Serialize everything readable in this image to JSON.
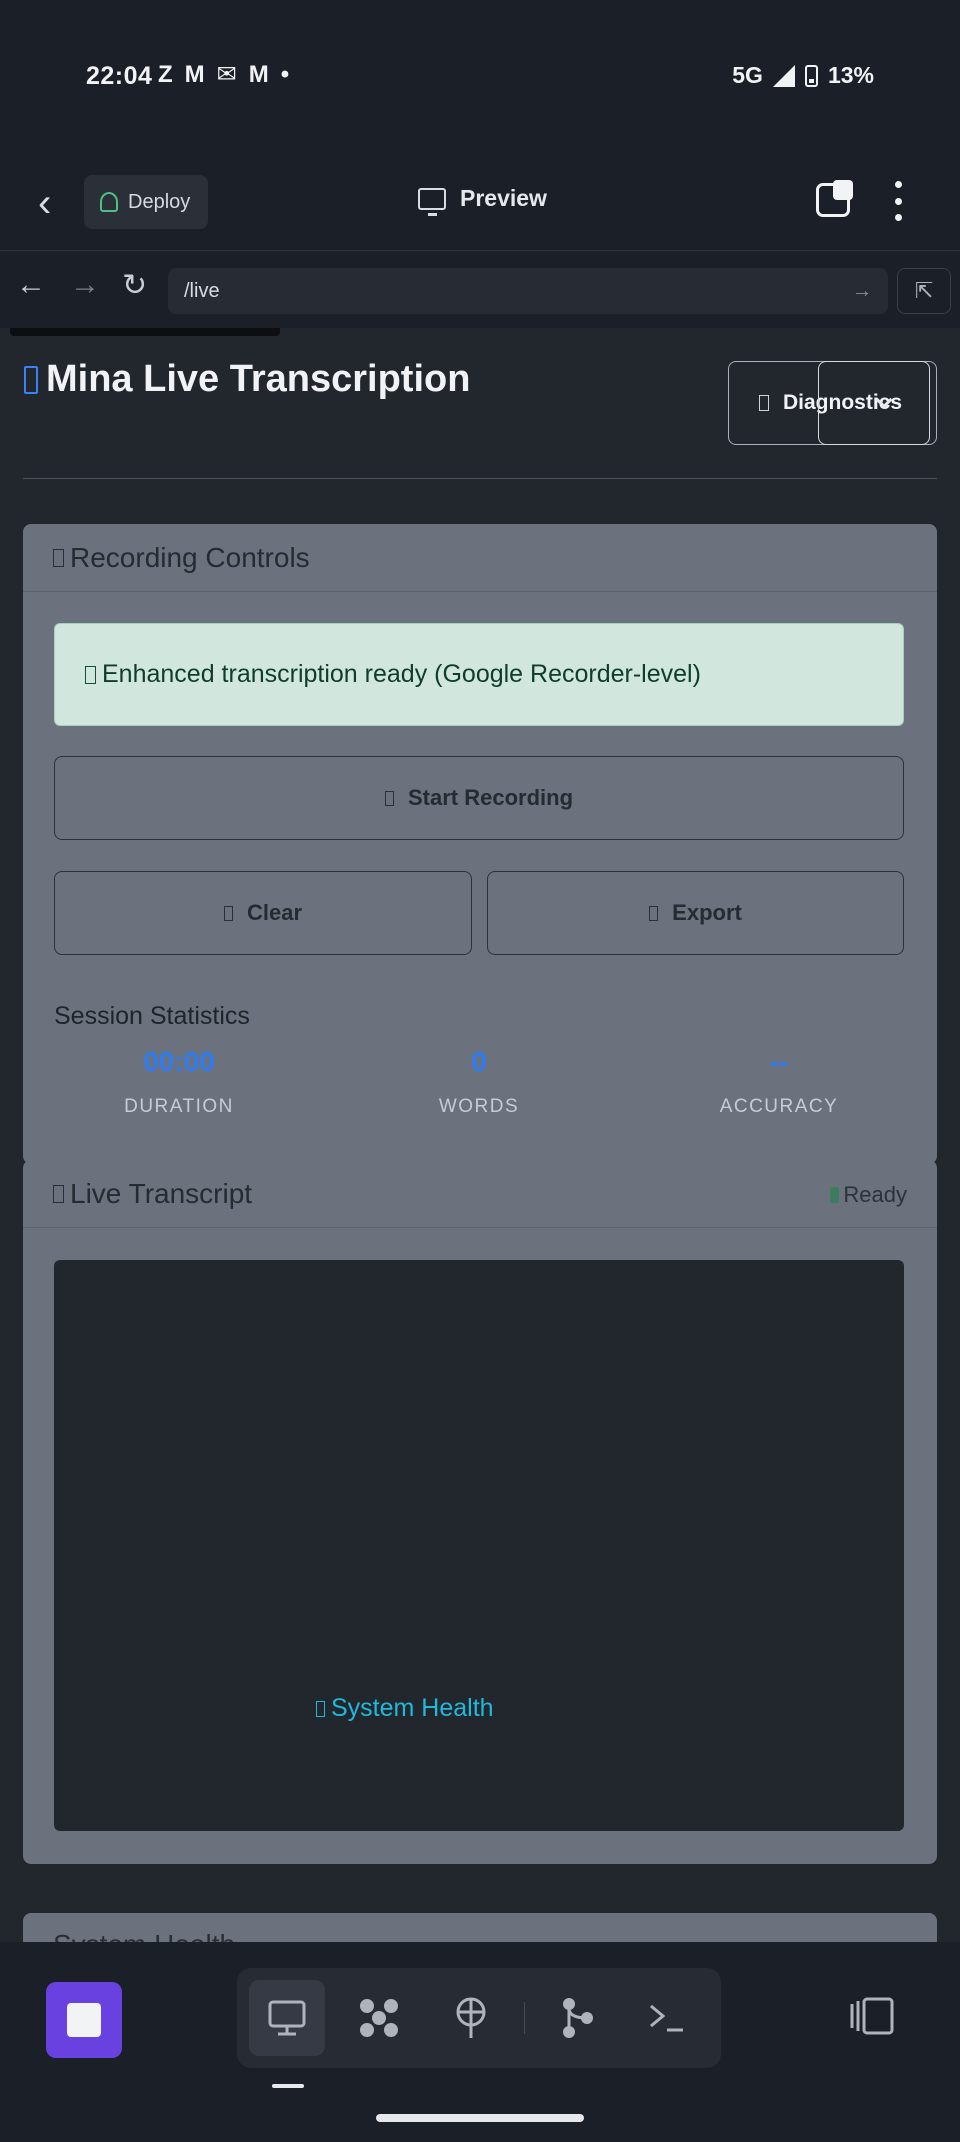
{
  "status_bar": {
    "time": "22:04",
    "notification_icons": [
      "Z",
      "M",
      "✉",
      "M",
      "•"
    ],
    "network": "5G",
    "battery": "13%"
  },
  "app_header": {
    "deploy_label": "Deploy",
    "preview_label": "Preview"
  },
  "browser": {
    "url": "/live"
  },
  "page": {
    "title": "Mina Live Transcription",
    "diagnostics_label": "Diagnostics",
    "recording_card": {
      "title": "Recording Controls",
      "alert": "Enhanced transcription ready (Google Recorder-level)",
      "start_label": "Start Recording",
      "clear_label": "Clear",
      "export_label": "Export",
      "stats_heading": "Session Statistics",
      "stats": [
        {
          "value": "00:00",
          "label": "DURATION"
        },
        {
          "value": "0",
          "label": "WORDS"
        },
        {
          "value": "--",
          "label": "ACCURACY"
        }
      ]
    },
    "transcript_card": {
      "title": "Live Transcript",
      "status": "Ready",
      "link": "System Health"
    },
    "health_card": {
      "title": "System Health"
    }
  },
  "bottom_bar": {
    "tools": [
      "monitor-icon",
      "workflow-icon",
      "deploy-icon",
      "git-icon",
      "terminal-icon"
    ]
  },
  "colors": {
    "accent": "#6941e0",
    "stat_value": "#2f7cf0",
    "alert_bg": "#d1e7dd",
    "link": "#22b8d9",
    "card_bg": "#6b727e"
  }
}
